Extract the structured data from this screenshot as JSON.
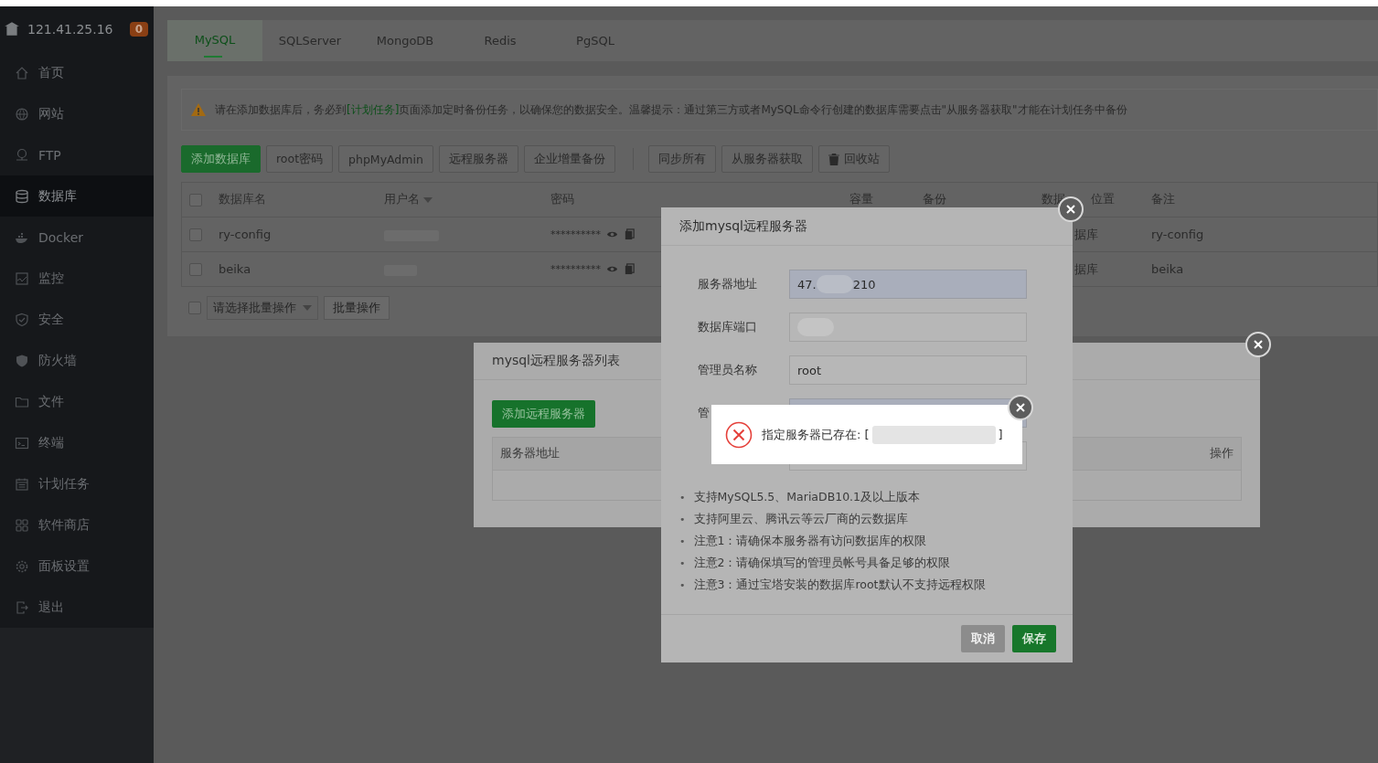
{
  "server": {
    "ip": "121.41.25.16",
    "badge": "0"
  },
  "sidebar": {
    "items": [
      {
        "label": "首页",
        "selected": false
      },
      {
        "label": "网站",
        "selected": false
      },
      {
        "label": "FTP",
        "selected": false
      },
      {
        "label": "数据库",
        "selected": true
      },
      {
        "label": "Docker",
        "selected": false
      },
      {
        "label": "监控",
        "selected": false
      },
      {
        "label": "安全",
        "selected": false
      },
      {
        "label": "防火墙",
        "selected": false
      },
      {
        "label": "文件",
        "selected": false
      },
      {
        "label": "终端",
        "selected": false
      },
      {
        "label": "计划任务",
        "selected": false
      },
      {
        "label": "软件商店",
        "selected": false
      },
      {
        "label": "面板设置",
        "selected": false
      },
      {
        "label": "退出",
        "selected": false
      }
    ]
  },
  "tabs": [
    {
      "label": "MySQL",
      "selected": true
    },
    {
      "label": "SQLServer",
      "selected": false
    },
    {
      "label": "MongoDB",
      "selected": false
    },
    {
      "label": "Redis",
      "selected": false
    },
    {
      "label": "PgSQL",
      "selected": false
    }
  ],
  "notice": {
    "before": "请在添加数据库后，务必到",
    "link": "[计划任务]",
    "after": "页面添加定时备份任务，以确保您的数据安全。温馨提示：通过第三方或者MySQL命令行创建的数据库需要点击\"从服务器获取\"才能在计划任务中备份"
  },
  "toolbar": {
    "groups": [
      [
        {
          "label": "添加数据库",
          "kind": "primary"
        },
        {
          "label": "root密码",
          "kind": "plain"
        },
        {
          "label": "phpMyAdmin",
          "kind": "plain"
        },
        {
          "label": "远程服务器",
          "kind": "plain"
        },
        {
          "label": "企业增量备份",
          "kind": "plain"
        }
      ],
      [
        {
          "label": "同步所有",
          "kind": "plain"
        },
        {
          "label": "从服务器获取",
          "kind": "plain"
        },
        {
          "label": "回收站",
          "kind": "trash"
        }
      ]
    ]
  },
  "table": {
    "select_all_checked": false,
    "columns": [
      {
        "label": "数据库名",
        "sortable": false
      },
      {
        "label": "用户名",
        "sortable": true
      },
      {
        "label": "密码",
        "sortable": false
      },
      {
        "label": "容量",
        "sortable": false
      },
      {
        "label": "备份",
        "sortable": false
      },
      {
        "label": "数据",
        "label_after": "位置"
      },
      {
        "label": "备注",
        "sortable": false
      }
    ],
    "rows": [
      {
        "checked": false,
        "name": "ry-config",
        "username_redacted": true,
        "password": "**********",
        "location": "据库",
        "remark": "ry-config"
      },
      {
        "checked": false,
        "name": "beika",
        "username_redacted": true,
        "password": "**********",
        "location": "据库",
        "remark": "beika"
      }
    ]
  },
  "batch": {
    "checked": false,
    "placeholder": "请选择批量操作",
    "button": "批量操作"
  },
  "remote_list_modal": {
    "title": "mysql远程服务器列表",
    "add_button": "添加远程服务器",
    "columns": [
      "服务器地址",
      "操作"
    ]
  },
  "add_dialog": {
    "title": "添加mysql远程服务器",
    "fields": [
      {
        "label": "服务器地址",
        "value_before": "47.",
        "value_after": "210",
        "redacted": true,
        "highlighted": true
      },
      {
        "label": "数据库端口",
        "redacted": true,
        "highlighted": false
      },
      {
        "label": "管理员名称",
        "value_before": "root",
        "redacted": false,
        "highlighted": false
      },
      {
        "label": "管",
        "redacted": false,
        "highlighted": true
      },
      {
        "redacted": false,
        "highlighted": false
      }
    ],
    "notes": [
      {
        "bullet": "•",
        "text": "支持MySQL5.5、MariaDB10.1及以上版本"
      },
      {
        "bullet": "•",
        "text": "支持阿里云、腾讯云等云厂商的云数据库"
      },
      {
        "bullet": "•",
        "text": "注意1：请确保本服务器有访问数据库的权限"
      },
      {
        "bullet": "•",
        "text": "注意2：请确保填写的管理员帐号具备足够的权限"
      },
      {
        "bullet": "•",
        "text": "注意3：通过宝塔安装的数据库root默认不支持远程权限"
      }
    ],
    "buttons": [
      {
        "label": "取消",
        "kind": "secondary"
      },
      {
        "label": "保存",
        "kind": "primary"
      }
    ]
  },
  "message": {
    "text": "指定服务器已存在: [",
    "redacted": true,
    "text_end": "]"
  }
}
